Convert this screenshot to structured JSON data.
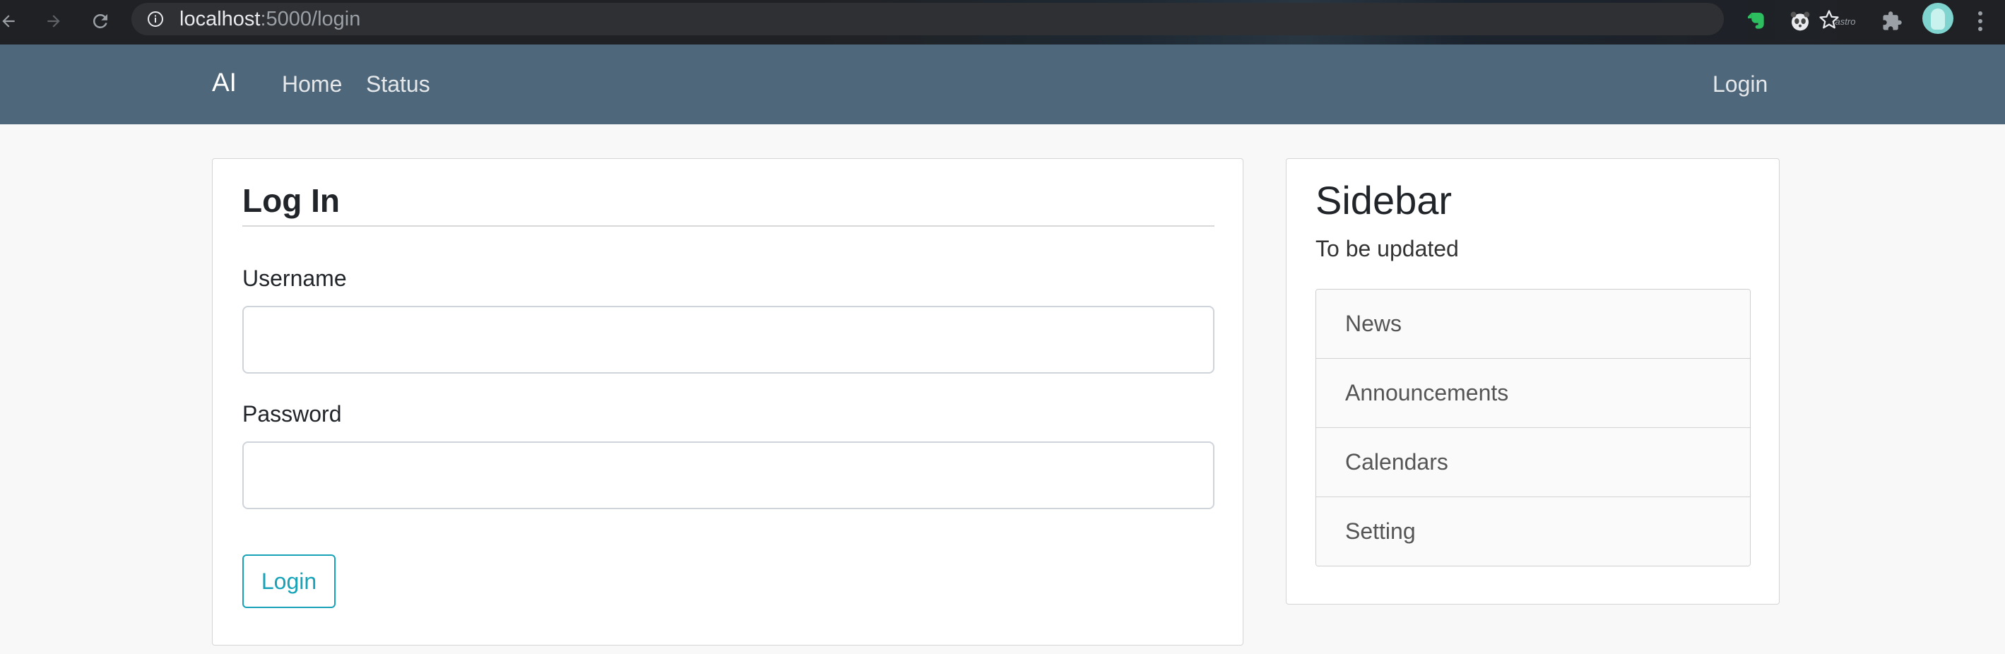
{
  "browser": {
    "url_host": "localhost",
    "url_path": ":5000/login",
    "extension_astro_label": "astro"
  },
  "navbar": {
    "brand": "AI",
    "links": {
      "home": "Home",
      "status": "Status",
      "login": "Login"
    }
  },
  "login_form": {
    "title": "Log In",
    "username_label": "Username",
    "username_value": "",
    "password_label": "Password",
    "password_value": "",
    "submit_label": "Login"
  },
  "sidebar": {
    "title": "Sidebar",
    "subtitle": "To be updated",
    "items": [
      {
        "label": "News"
      },
      {
        "label": "Announcements"
      },
      {
        "label": "Calendars"
      },
      {
        "label": "Setting"
      }
    ]
  },
  "colors": {
    "navbar_bg": "#4f677a",
    "page_bg": "#f8f8f8",
    "button_accent": "#17a2b8",
    "chrome_bg": "#202124"
  }
}
